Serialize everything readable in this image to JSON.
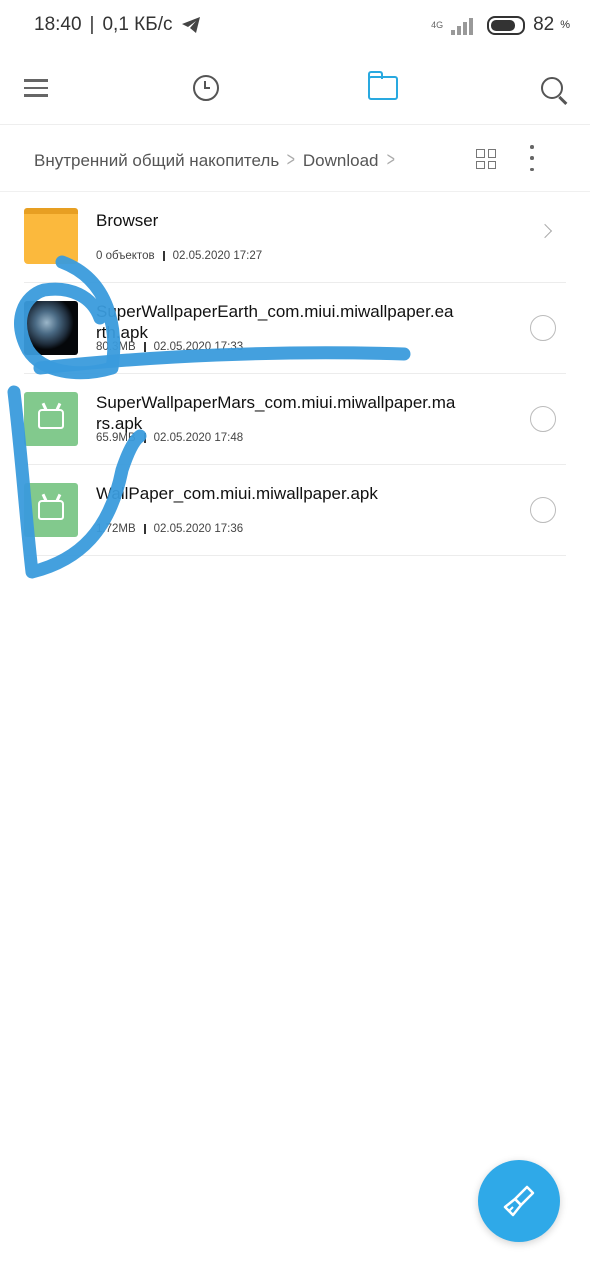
{
  "status_bar": {
    "time": "18:40",
    "speed": "0,1 КБ/с",
    "network": "4G",
    "battery": "82",
    "battery_unit": "%"
  },
  "toolbar": {
    "icons": [
      "menu-icon",
      "history-clock-icon",
      "folder-icon",
      "search-icon"
    ],
    "active": "folder-icon",
    "accent_color": "#29a9e0"
  },
  "breadcrumb": {
    "root": "Внутренний общий накопитель",
    "current": "Download"
  },
  "files": [
    {
      "name": "Browser",
      "count": "0 объектов",
      "date": "02.05.2020 17:27",
      "type": "folder"
    },
    {
      "name": "SuperWallpaperEarth_com.miui.miwallpaper.earth.apk",
      "size": "80.3MB",
      "date": "02.05.2020 17:33",
      "type": "apk-earth"
    },
    {
      "name": "SuperWallpaperMars_com.miui.miwallpaper.mars.apk",
      "size": "65.9MB",
      "date": "02.05.2020 17:48",
      "type": "apk"
    },
    {
      "name": "WallPaper_com.miui.miwallpaper.apk",
      "size": "1.72MB",
      "date": "02.05.2020 17:36",
      "type": "apk"
    }
  ],
  "fab": {
    "icon": "clean-brush-icon",
    "color": "#2fa9e8"
  }
}
